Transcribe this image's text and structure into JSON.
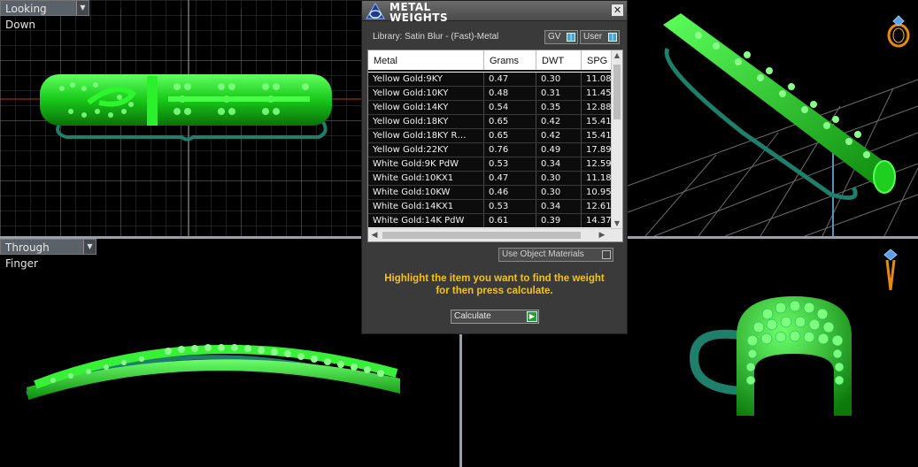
{
  "viewports": {
    "top_left_label": "Looking Down",
    "bottom_left_label": "Through Finger"
  },
  "dialog": {
    "title": "METAL WEIGHTS",
    "library": "Library: Satin Blur - (Fast)-Metal",
    "gv_label": "GV",
    "user_label": "User",
    "columns": {
      "metal": "Metal",
      "grams": "Grams",
      "dwt": "DWT",
      "spg": "SPG"
    },
    "rows": [
      {
        "metal": "Yellow Gold:9KY",
        "grams": "0.47",
        "dwt": "0.30",
        "spg": "11.08"
      },
      {
        "metal": "Yellow Gold:10KY",
        "grams": "0.48",
        "dwt": "0.31",
        "spg": "11.45"
      },
      {
        "metal": "Yellow Gold:14KY",
        "grams": "0.54",
        "dwt": "0.35",
        "spg": "12.88"
      },
      {
        "metal": "Yellow Gold:18KY",
        "grams": "0.65",
        "dwt": "0.42",
        "spg": "15.41"
      },
      {
        "metal": "Yellow Gold:18KY R…",
        "grams": "0.65",
        "dwt": "0.42",
        "spg": "15.41"
      },
      {
        "metal": "Yellow Gold:22KY",
        "grams": "0.76",
        "dwt": "0.49",
        "spg": "17.89"
      },
      {
        "metal": "White Gold:9K PdW",
        "grams": "0.53",
        "dwt": "0.34",
        "spg": "12.59"
      },
      {
        "metal": "White Gold:10KX1",
        "grams": "0.47",
        "dwt": "0.30",
        "spg": "11.18"
      },
      {
        "metal": "White Gold:10KW",
        "grams": "0.46",
        "dwt": "0.30",
        "spg": "10.95"
      },
      {
        "metal": "White Gold:14KX1",
        "grams": "0.53",
        "dwt": "0.34",
        "spg": "12.61"
      },
      {
        "metal": "White Gold:14K PdW",
        "grams": "0.61",
        "dwt": "0.39",
        "spg": "14.37"
      }
    ],
    "use_object_materials": "Use Object Materials",
    "hint_line1": "Highlight the item you want to find the weight",
    "hint_line2": "for then press calculate.",
    "calculate_label": "Calculate",
    "close_glyph": "✕"
  },
  "colors": {
    "model_green": "#22dd22",
    "hint_text": "#f2c21b",
    "viewport_bg": "#000000"
  }
}
